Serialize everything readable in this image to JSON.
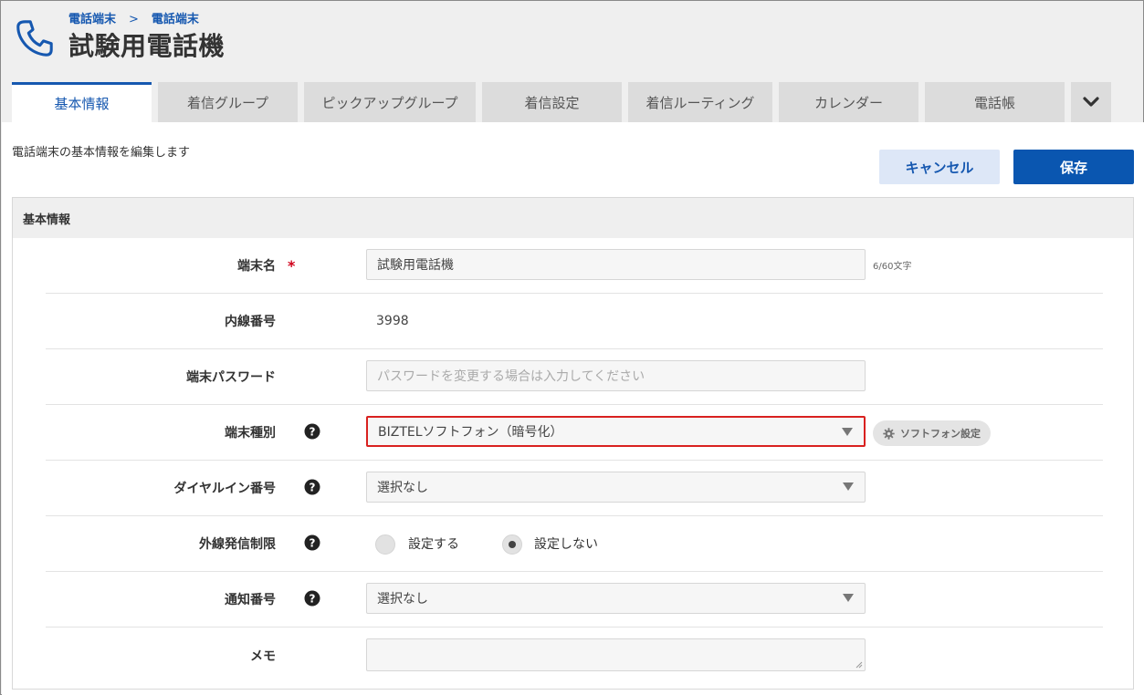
{
  "header": {
    "breadcrumb": [
      "電話端末",
      "電話端末"
    ],
    "breadcrumb_sep": ">",
    "title": "試験用電話機"
  },
  "tabs": [
    {
      "label": "基本情報",
      "active": true
    },
    {
      "label": "着信グループ"
    },
    {
      "label": "ピックアップグループ"
    },
    {
      "label": "着信設定"
    },
    {
      "label": "着信ルーティング"
    },
    {
      "label": "カレンダー"
    },
    {
      "label": "電話帳"
    }
  ],
  "content": {
    "description": "電話端末の基本情報を編集します",
    "cancel_label": "キャンセル",
    "save_label": "保存"
  },
  "panel": {
    "title": "基本情報",
    "fields": {
      "device_name": {
        "label": "端末名",
        "required_mark": "*",
        "value": "試験用電話機",
        "counter": "6/60文字"
      },
      "extension": {
        "label": "内線番号",
        "value": "3998"
      },
      "password": {
        "label": "端末パスワード",
        "placeholder": "パスワードを変更する場合は入力してください"
      },
      "device_type": {
        "label": "端末種別",
        "value": "BIZTELソフトフォン（暗号化）",
        "settings_button": "ソフトフォン設定"
      },
      "dial_in": {
        "label": "ダイヤルイン番号",
        "value": "選択なし"
      },
      "outbound_limit": {
        "label": "外線発信制限",
        "options": [
          "設定する",
          "設定しない"
        ],
        "selected": "設定しない"
      },
      "notify_number": {
        "label": "通知番号",
        "value": "選択なし"
      },
      "memo": {
        "label": "メモ",
        "value": ""
      }
    }
  },
  "colors": {
    "accent": "#1658b0",
    "save_button": "#0a56b0",
    "highlight_border": "#d9211f",
    "required": "#d0021b"
  },
  "icons": [
    "phone-icon",
    "chevron-down-icon",
    "help-icon",
    "gear-icon",
    "dropdown-arrow-icon"
  ]
}
